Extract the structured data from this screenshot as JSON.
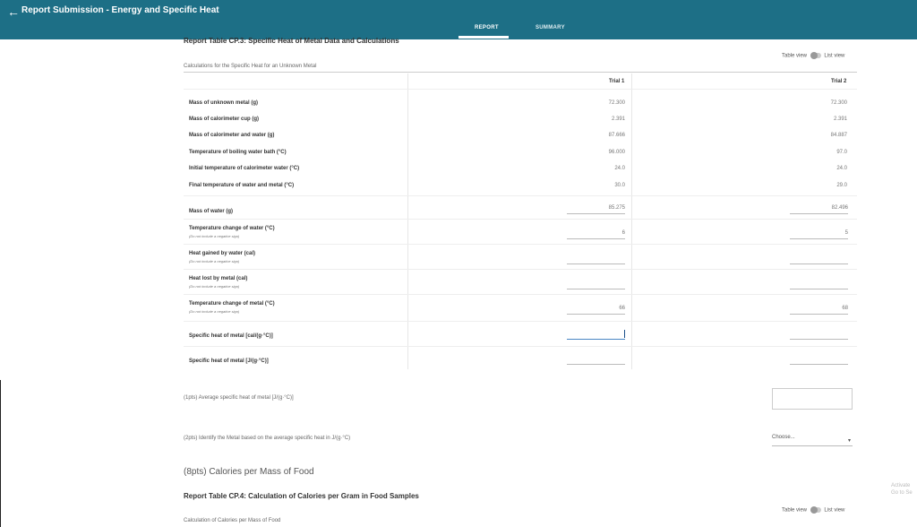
{
  "header": {
    "back_icon": "arrow-left-icon",
    "title": "Report Submission - Energy and Specific Heat",
    "tabs": [
      {
        "label": "REPORT",
        "active": true
      },
      {
        "label": "SUMMARY",
        "active": false
      }
    ]
  },
  "section": {
    "title": "Report Table CP.3: Specific Heat of Metal Data and Calculations",
    "toggle": {
      "table_label": "Table view",
      "list_label": "List view"
    },
    "calc_label": "Calculations for the Specific Heat for an Unknown Metal",
    "columns": [
      "Trial 1",
      "Trial 2"
    ],
    "rows": [
      {
        "label": "Mass of unknown metal (g)",
        "t1": "72.300",
        "t2": "72.300"
      },
      {
        "label": "Mass of calorimeter cup (g)",
        "t1": "2.391",
        "t2": "2.391"
      },
      {
        "label": "Mass of calorimeter and water (g)",
        "t1": "87.666",
        "t2": "84.887"
      },
      {
        "label": "Temperature of boiling water bath (°C)",
        "t1": "96.000",
        "t2": "97.0"
      },
      {
        "label": "Initial temperature of calorimeter water (°C)",
        "t1": "24.0",
        "t2": "24.0"
      },
      {
        "label": "Final temperature of water and metal (°C)",
        "t1": "30.0",
        "t2": "29.0"
      }
    ],
    "calc_rows": [
      {
        "label": "Mass of water (g)",
        "sub": "",
        "t1": "85.275",
        "t2": "82.496"
      },
      {
        "label": "Temperature change of water (°C)",
        "sub": "(Do not include a negative sign)",
        "t1": "6",
        "t2": "5"
      },
      {
        "label": "Heat gained by water (cal)",
        "sub": "(Do not include a negative sign)",
        "t1": "",
        "t2": ""
      },
      {
        "label": "Heat lost by metal (cal)",
        "sub": "(Do not include a negative sign)",
        "t1": "",
        "t2": ""
      },
      {
        "label": "Temperature change of metal (°C)",
        "sub": "(Do not include a negative sign)",
        "t1": "66",
        "t2": "68"
      },
      {
        "label": "Specific heat of metal [cal/(g·°C)]",
        "sub": "",
        "t1": "",
        "t2": ""
      },
      {
        "label": "Specific heat of metal [J/(g·°C)]",
        "sub": "",
        "t1": "",
        "t2": ""
      }
    ]
  },
  "questions": {
    "q1": "(1pts)  Average specific heat of metal [J/(g·°C)]",
    "q2": "(2pts)  Identify the Metal based on the average specific heat in J/(g·°C)",
    "select_value": "Choose..."
  },
  "food": {
    "heading": "(8pts) Calories per Mass of Food",
    "table_title": "Report Table CP.4: Calculation of Calories per Gram in Food Samples",
    "calc_label": "Calculation of Calories per Mass of Food",
    "toggle": {
      "table_label": "Table view",
      "list_label": "List view"
    }
  },
  "watermark": "Activate Go to Se"
}
